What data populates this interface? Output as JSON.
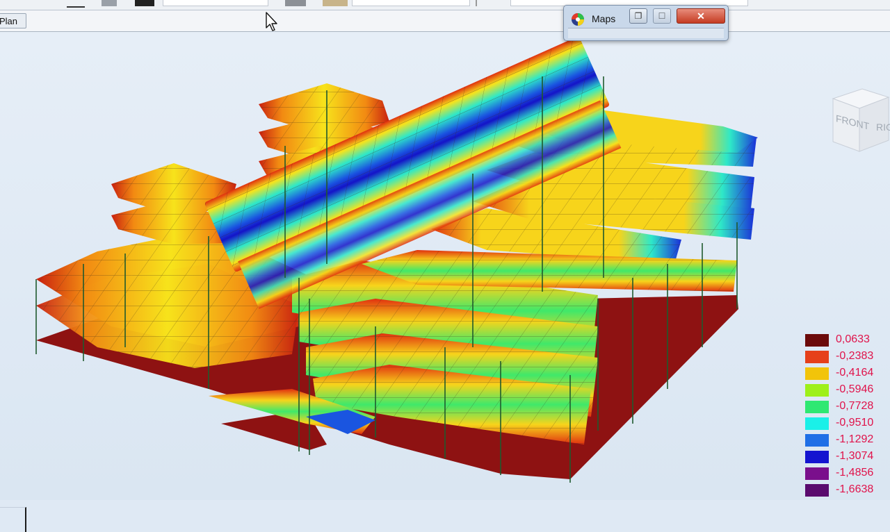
{
  "toolbar": {
    "tab_label": "Plan"
  },
  "maps_window": {
    "title": "Maps",
    "restore_glyph": "❐",
    "maximize_glyph": "☐",
    "close_glyph": "✕"
  },
  "view_cube": {
    "face_front": "FRONT",
    "face_right": "RIGHT"
  },
  "legend": {
    "items": [
      {
        "value": "0,0633",
        "color": "#6b0a0a"
      },
      {
        "value": "-0,2383",
        "color": "#e6401a"
      },
      {
        "value": "-0,4164",
        "color": "#f2c40a"
      },
      {
        "value": "-0,5946",
        "color": "#9ef01a"
      },
      {
        "value": "-0,7728",
        "color": "#2ee872"
      },
      {
        "value": "-0,9510",
        "color": "#1af0e8"
      },
      {
        "value": "-1,1292",
        "color": "#1f6fe6"
      },
      {
        "value": "-1,3074",
        "color": "#1414d0"
      },
      {
        "value": "-1,4856",
        "color": "#7a0f8c"
      },
      {
        "value": "-1,6638",
        "color": "#5a0a6e"
      }
    ]
  },
  "scene": {
    "description_colors": {
      "base_slab": "#8e1212",
      "column": "#1f5a2e",
      "mesh_line": "#3a2a1a"
    }
  }
}
